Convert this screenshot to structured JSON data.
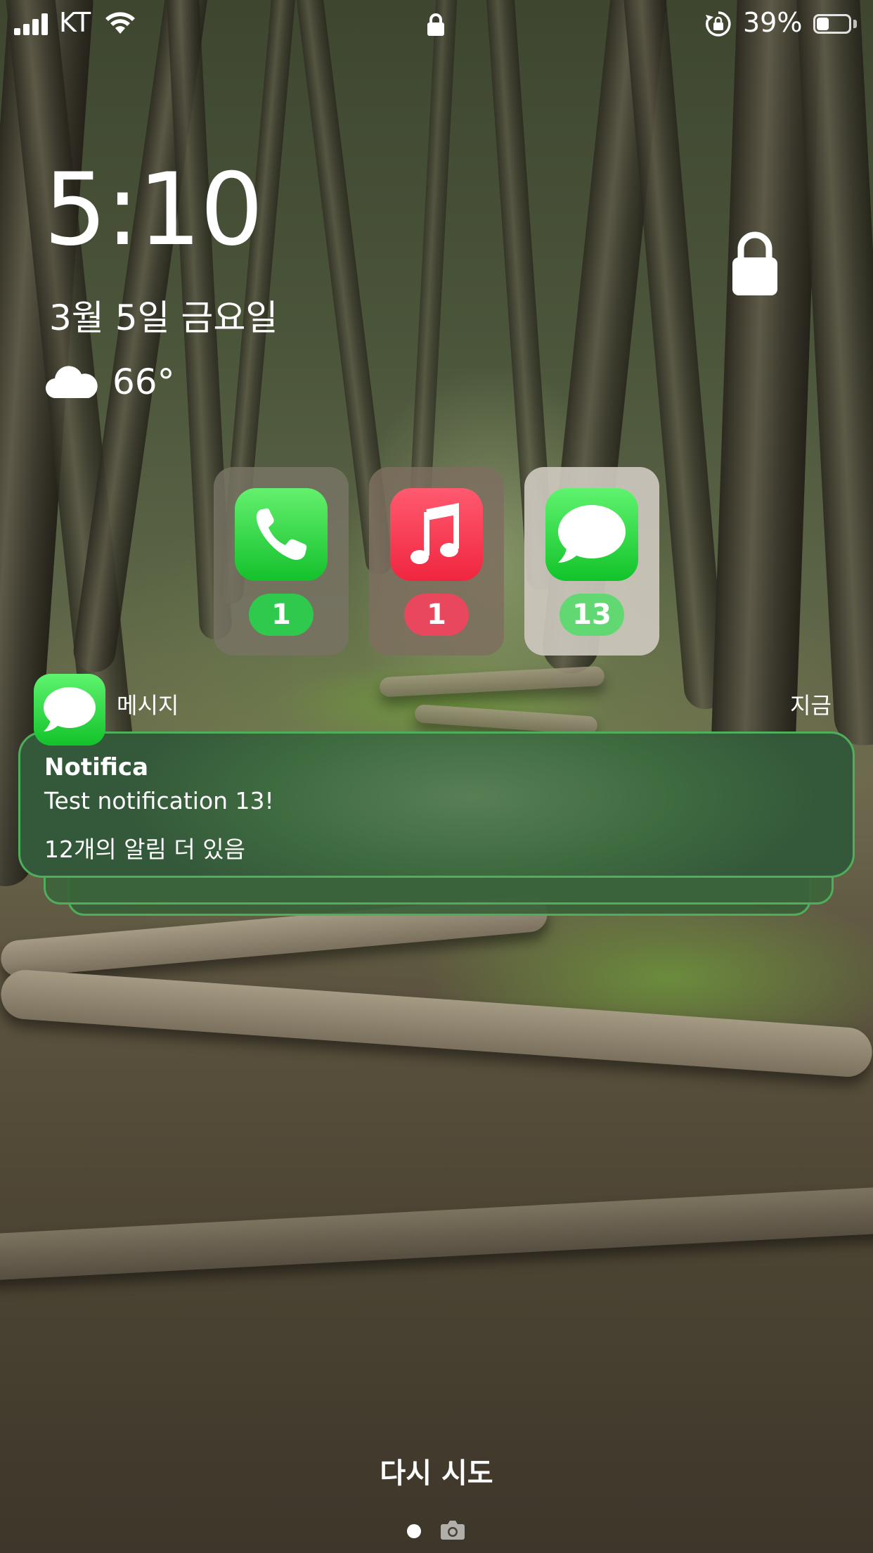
{
  "status_bar": {
    "carrier": "KT",
    "battery_percent": "39%",
    "battery_level": 0.39,
    "icons": [
      "signal-icon",
      "wifi-icon",
      "lock-icon",
      "orientation-lock-icon",
      "battery-icon"
    ]
  },
  "lock_screen": {
    "time": "5:10",
    "date": "3월 5일 금요일",
    "weather": {
      "icon": "cloud-icon",
      "temperature": "66°"
    },
    "lock_icon": "padlock-icon"
  },
  "app_badges": [
    {
      "app": "phone-app-icon",
      "count": "1",
      "color": "#2ac94a"
    },
    {
      "app": "music-app-icon",
      "count": "1",
      "color": "#f6405f"
    },
    {
      "app": "messages-app-icon",
      "count": "13",
      "color": "#2ac94a"
    }
  ],
  "notification": {
    "app_name": "메시지",
    "time": "지금",
    "title": "Notifica",
    "body": "Test notification 13!",
    "more": "12개의 알림 더 있음",
    "accent": "#4fae5c"
  },
  "bottom": {
    "retry_label": "다시 시도",
    "icons": [
      "page-dot-icon",
      "camera-icon"
    ]
  }
}
